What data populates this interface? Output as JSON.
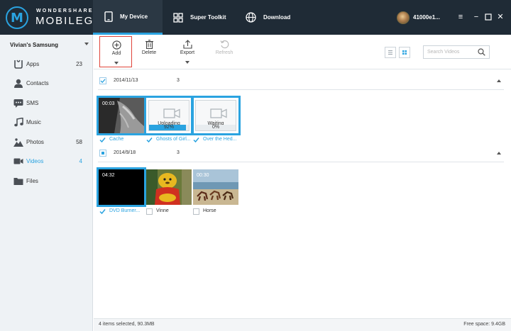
{
  "brand": {
    "top": "WONDERSHARE",
    "main": "MOBILEGO"
  },
  "nav": {
    "tabs": [
      {
        "label": "My Device",
        "icon": "phone-icon",
        "active": true
      },
      {
        "label": "Super Toolkit",
        "icon": "grid-icon",
        "active": false
      },
      {
        "label": "Download",
        "icon": "globe-icon",
        "active": false
      }
    ]
  },
  "user": {
    "name": "41000e1..."
  },
  "window": {
    "menu_icon": "menu-icon",
    "minimize_icon": "minimize-icon",
    "maximize_icon": "maximize-icon",
    "close_icon": "close-icon"
  },
  "sidebar": {
    "device": "Vivian's Samsung",
    "items": [
      {
        "label": "Apps",
        "count": "23",
        "icon": "apps-icon"
      },
      {
        "label": "Contacts",
        "count": "",
        "icon": "contacts-icon"
      },
      {
        "label": "SMS",
        "count": "",
        "icon": "sms-icon"
      },
      {
        "label": "Music",
        "count": "",
        "icon": "music-icon"
      },
      {
        "label": "Photos",
        "count": "58",
        "icon": "photos-icon"
      },
      {
        "label": "Videos",
        "count": "4",
        "icon": "videos-icon",
        "active": true
      },
      {
        "label": "Files",
        "count": "",
        "icon": "folder-icon"
      }
    ]
  },
  "toolbar": {
    "add": "Add",
    "delete": "Delete",
    "export": "Export",
    "refresh": "Refresh",
    "search_placeholder": "Search Videos"
  },
  "groups": [
    {
      "date": "2014/11/13",
      "count": "3",
      "items": [
        {
          "name": "Cache",
          "time": "00:03",
          "selected": true
        },
        {
          "name": "Ghosts of Girl...",
          "status": "Uploading",
          "progress_label": "92%",
          "progress": 0.92,
          "selected": true
        },
        {
          "name": "Over the Hed...",
          "status": "Waiting",
          "progress_label": "0%",
          "progress": 0,
          "selected": true
        }
      ]
    },
    {
      "date": "2014/9/18",
      "count": "3",
      "items": [
        {
          "name": "DVD Burner...",
          "time": "04:32",
          "selected": true
        },
        {
          "name": "Vinne",
          "time": "",
          "selected": false
        },
        {
          "name": "Horse",
          "time": "00:30",
          "selected": false
        }
      ]
    }
  ],
  "status": {
    "selected": "4 items selected, 90.3MB",
    "free": "Free space: 9.4GB"
  },
  "colors": {
    "accent": "#2aa3e0",
    "topbar": "#1f2b36",
    "sidebar": "#eef2f5",
    "add_highlight": "#e0443a"
  }
}
